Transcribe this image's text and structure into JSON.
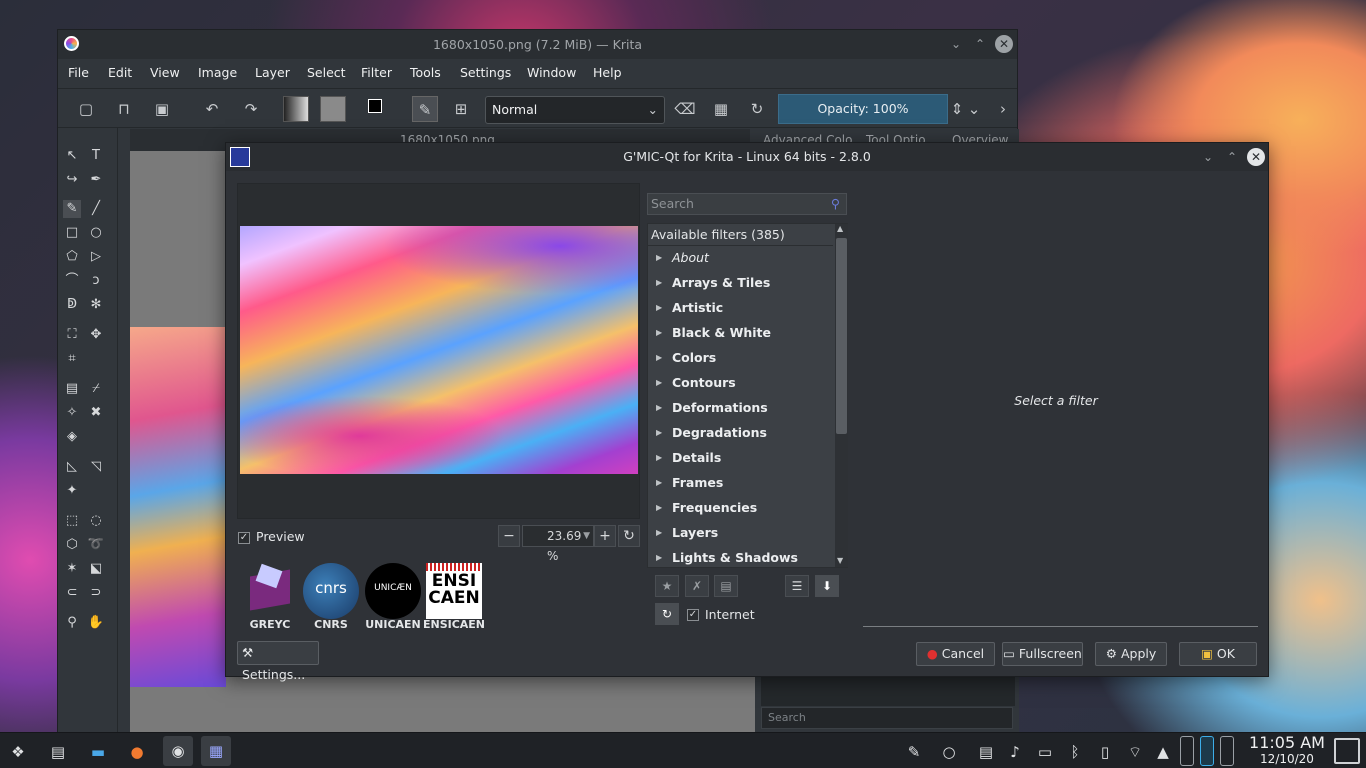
{
  "krita": {
    "title": "1680x1050.png (7.2 MiB) — Krita",
    "menu": [
      "File",
      "Edit",
      "View",
      "Image",
      "Layer",
      "Select",
      "Filter",
      "Tools",
      "Settings",
      "Window",
      "Help"
    ],
    "blend_mode": "Normal",
    "opacity": "Opacity: 100%",
    "canvas_tab": "1680x1050.png",
    "docker_tabs": [
      "Advanced Colo...",
      "Tool Optio...",
      "Overview"
    ],
    "brush_search_placeholder": "Search"
  },
  "gmic": {
    "title": "G'MIC-Qt for Krita - Linux 64 bits - 2.8.0",
    "preview_label": "Preview",
    "preview_checked": true,
    "zoom": "23.69 %",
    "logos": [
      "GREYC",
      "CNRS",
      "UNICAEN",
      "ENSICAEN"
    ],
    "logo_texts": {
      "cnrs": "cnrs",
      "unicaen": "UNICÆN",
      "ensicaen_line1": "ENSI",
      "ensicaen_line2": "CAEN"
    },
    "settings_label": "Settings...",
    "search_placeholder": "Search",
    "filters_header": "Available filters (385)",
    "filters": [
      "About",
      "Arrays & Tiles",
      "Artistic",
      "Black & White",
      "Colors",
      "Contours",
      "Deformations",
      "Degradations",
      "Details",
      "Frames",
      "Frequencies",
      "Layers",
      "Lights & Shadows"
    ],
    "internet_label": "Internet",
    "internet_checked": true,
    "placeholder_text": "Select a filter",
    "buttons": {
      "cancel": "Cancel",
      "fullscreen": "Fullscreen",
      "apply": "Apply",
      "ok": "OK"
    }
  },
  "taskbar": {
    "time": "11:05 AM",
    "date": "12/10/20"
  }
}
